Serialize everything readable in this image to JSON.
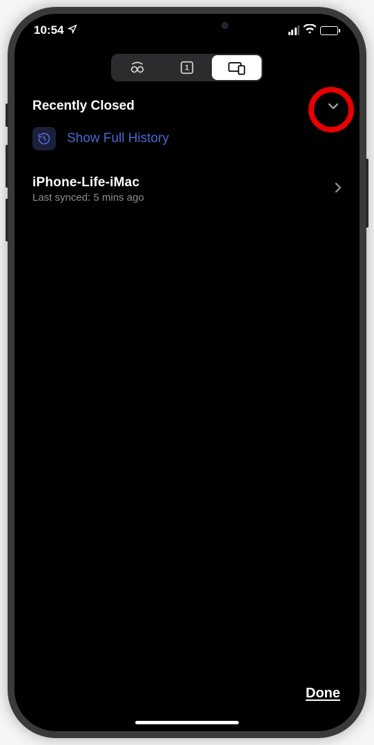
{
  "status": {
    "time": "10:54",
    "location_icon": "location-arrow"
  },
  "tabs": {
    "private": {
      "label": "incognito"
    },
    "count": {
      "value": "1"
    },
    "devices": {
      "label": "devices",
      "active": true
    }
  },
  "sections": {
    "recently_closed": {
      "title": "Recently Closed",
      "history_link": "Show Full History"
    }
  },
  "devices": [
    {
      "name": "iPhone-Life-iMac",
      "synced": "Last synced: 5 mins ago"
    }
  ],
  "footer": {
    "done": "Done"
  },
  "colors": {
    "accent": "#4c68d7",
    "highlight": "#e60000"
  }
}
